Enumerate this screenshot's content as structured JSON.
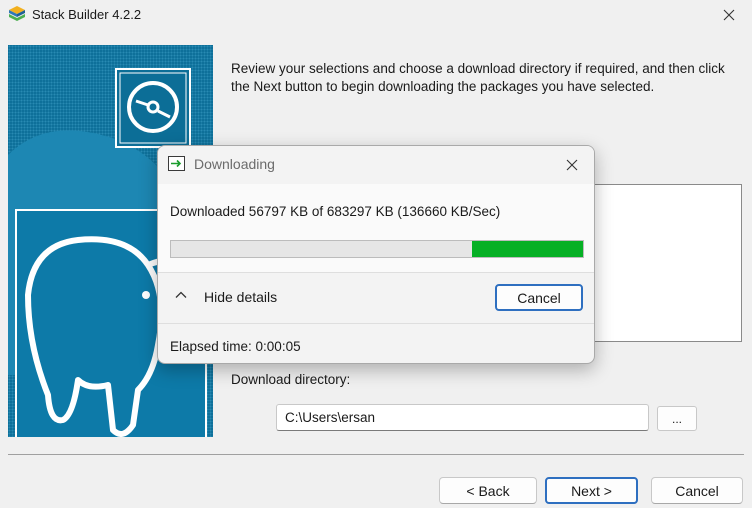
{
  "window": {
    "title": "Stack Builder 4.2.2",
    "close_icon": "close-icon",
    "app_icon": "stack-builder-icon"
  },
  "intro": {
    "text": "Review your selections and choose a download directory if required, and then click the Next button to begin downloading the packages you have selected."
  },
  "directory": {
    "label": "Download directory:",
    "value": "C:\\Users\\ersan",
    "browse_label": "..."
  },
  "nav": {
    "back_label": "< Back",
    "next_label": "Next >",
    "cancel_label": "Cancel"
  },
  "download_dialog": {
    "title": "Downloading",
    "status": "Downloaded 56797 KB of  683297 KB (136660 KB/Sec)",
    "progress_fraction": 0.27,
    "details_toggle": "Hide details",
    "cancel_label": "Cancel",
    "elapsed": "Elapsed time: 0:00:05"
  },
  "colors": {
    "banner": "#0c6e97",
    "progress": "#06b025",
    "accent": "#2e6fc0"
  }
}
